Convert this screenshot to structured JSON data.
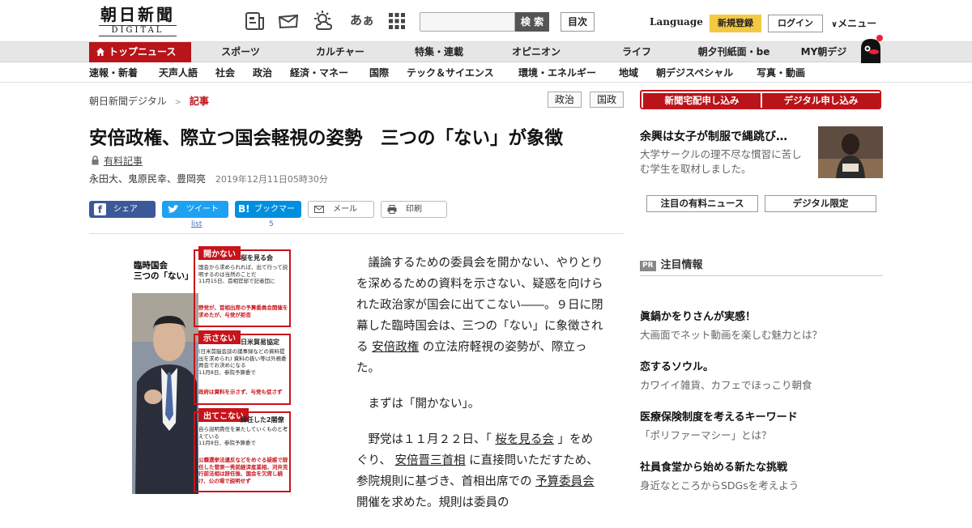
{
  "header": {
    "logo_jp": "朝日新聞",
    "logo_en": "DIGITAL",
    "icons": [
      "news-icon",
      "mail-icon",
      "weather-icon",
      "font-size-icon",
      "grid-icon"
    ],
    "font_icon_text": "あぁ",
    "search_button": "検 索",
    "toc_button": "目次",
    "language": "Language",
    "register": "新規登録",
    "login": "ログイン",
    "menu": "メニュー"
  },
  "nav_main": [
    "トップニュース",
    "スポーツ",
    "カルチャー",
    "特集・連載",
    "オピニオン",
    "ライフ",
    "朝夕刊紙面・be",
    "MY朝デジ"
  ],
  "nav_sub": [
    "速報・新着",
    "天声人語",
    "社会",
    "政治",
    "経済・マネー",
    "国際",
    "テック＆サイエンス",
    "環境・エネルギー",
    "地域",
    "朝デジスペシャル",
    "写真・動画"
  ],
  "breadcrumb": {
    "home": "朝日新聞デジタル",
    "sep": ">",
    "current": "記事"
  },
  "tags": [
    "政治",
    "国政"
  ],
  "article": {
    "title": "安倍政権、際立つ国会軽視の姿勢　三つの「ない」が象徴",
    "paid": "有料記事",
    "authors": "永田大、鬼原民幸、豊岡亮",
    "date": "2019年12月11日05時30分",
    "share": {
      "facebook": "シェア",
      "twitter": "ツイート",
      "hatena": "ブックマーク",
      "mail": "メール",
      "print": "印刷",
      "twitter_count": "list",
      "hatena_count": "5"
    },
    "p1_pre": "議論するための委員会を開かない、やりとりを深めるための資料を示さない、疑惑を向けられた政治家が国会に出てこない――。９日に閉幕した臨時国会は、三つの「ない」に象徴される",
    "p1_link": "安倍政権",
    "p1_post": "の立法府軽視の姿勢が、際立った。",
    "p2": "まずは「開かない」。",
    "p3_a": "野党は１１月２２日、「",
    "p3_link1": "桜を見る会",
    "p3_b": "」をめぐり、",
    "p3_link2": "安倍晋三首相",
    "p3_c": "に直接問いただすため、参院規則に基づき、首相出席での",
    "p3_link3": "予算委員会",
    "p3_d": "開催を求めた。規則は委員の",
    "figure": {
      "heading": "臨時国会\n三つの「ない」",
      "b1_title": "開かない",
      "b1_label": "桜を見る会",
      "b1_text": "国会から求められれば、出て行って説明するのは当然のことだ\n11月15日、首相官邸で記者団に",
      "b1_note": "野党が、首相出席の予算委員会開催を求めたが、与党が拒否",
      "b2_title": "示さない",
      "b2_label": "日米貿易協定",
      "b2_text": "(日米首脳会談の議事録などの資料提出を求められ) 資料の扱い等は外務委員会でお決めになる\n11月8日、参院予算委で",
      "b2_note": "政府は資料を示さず、与党も促さず",
      "b3_title": "出てこない",
      "b3_label": "辞任した2閣僚",
      "b3_text": "自ら説明責任を果たしていくものと考えている\n11月8日、参院予算委で",
      "b3_note": "公職選挙法違反などをめぐる疑惑で辞任した菅原一秀前経済産業相、河井克行前法相は辞任後、国会を欠席し続け、公の場で説明せず"
    }
  },
  "sidebar": {
    "btn_newspaper": "新聞宅配申し込み",
    "btn_digital": "デジタル申し込み",
    "promo_title": "余興は女子が制服で縄跳び…",
    "promo_desc": "大学サークルの理不尽な慣習に苦しむ学生を取材しました。",
    "tab1": "注目の有料ニュース",
    "tab2": "デジタル限定",
    "pr_badge": "PR",
    "pr_title": "注目情報",
    "items": [
      {
        "title": "眞鍋かをりさんが実感！",
        "desc": "大画面でネット動画を楽しむ魅力とは？"
      },
      {
        "title": "恋するソウル。",
        "desc": "カワイイ雑貨、カフェでほっこり朝食"
      },
      {
        "title": "医療保険制度を考えるキーワード",
        "desc": "「ポリファーマシー」とは？"
      },
      {
        "title": "社員食堂から始める新たな挑戦",
        "desc": "身近なところからSDGsを考えよう"
      }
    ]
  },
  "colors": {
    "brand_red": "#b8141a",
    "register_yellow": "#f5c842",
    "facebook": "#3b5998",
    "twitter": "#1da1f2",
    "hatena": "#008fde"
  }
}
